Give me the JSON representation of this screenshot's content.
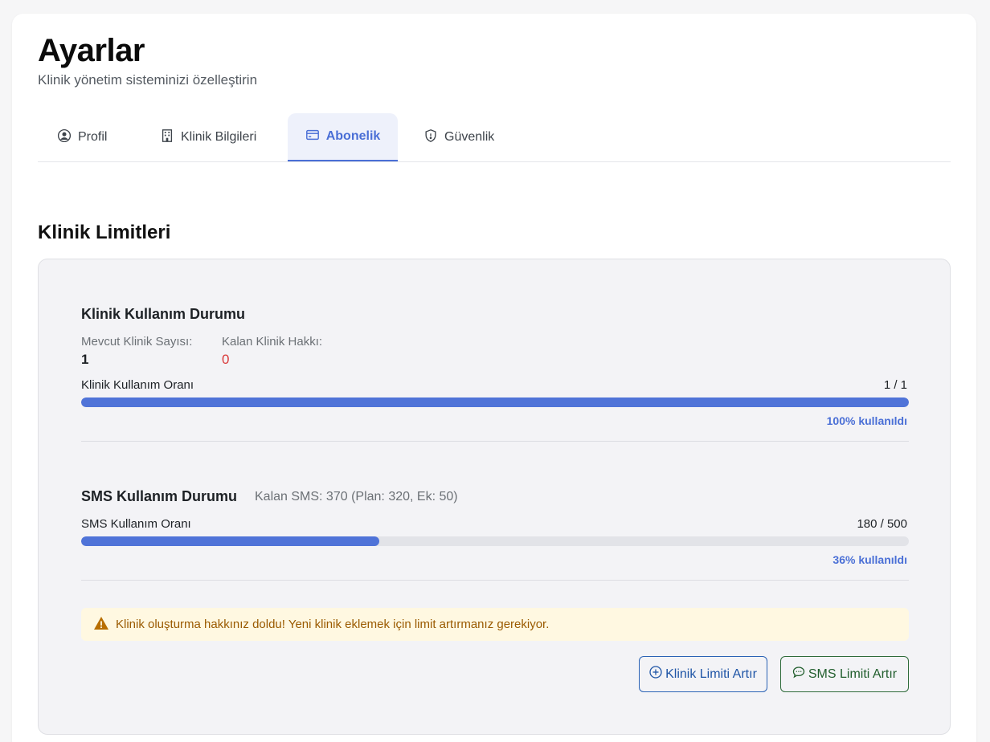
{
  "header": {
    "title": "Ayarlar",
    "subtitle": "Klinik yönetim sisteminizi özelleştirin"
  },
  "tabs": [
    {
      "label": "Profil",
      "icon": "user-circle-icon",
      "active": false
    },
    {
      "label": "Klinik Bilgileri",
      "icon": "building-icon",
      "active": false
    },
    {
      "label": "Abonelik",
      "icon": "credit-card-icon",
      "active": true
    },
    {
      "label": "Güvenlik",
      "icon": "shield-icon",
      "active": false
    }
  ],
  "section": {
    "title": "Klinik Limitleri"
  },
  "clinic_usage": {
    "title": "Klinik Kullanım Durumu",
    "current_label": "Mevcut Klinik Sayısı:",
    "current_value": "1",
    "remaining_label": "Kalan Klinik Hakkı:",
    "remaining_value": "0",
    "rate_label": "Klinik Kullanım Oranı",
    "rate_value": "1 / 1",
    "progress_percent": 100,
    "percent_text": "100% kullanıldı"
  },
  "sms_usage": {
    "title": "SMS Kullanım Durumu",
    "remaining_text": "Kalan SMS: 370 (Plan: 320, Ek: 50)",
    "rate_label": "SMS Kullanım Oranı",
    "rate_value": "180 / 500",
    "progress_percent": 36,
    "percent_text": "36% kullanıldı"
  },
  "alert": {
    "icon": "warning-icon",
    "text": "Klinik oluşturma hakkınız doldu! Yeni klinik eklemek için limit artırmanız gerekiyor."
  },
  "actions": {
    "clinic_limit_label": "Klinik Limiti Artır",
    "sms_limit_label": "SMS Limiti Artır"
  },
  "colors": {
    "accent": "#4a6fd6",
    "progress_fill": "#4f73d8",
    "danger": "#d93a3a",
    "warning_bg": "#fff8e1",
    "warning_text": "#9a5a00",
    "blue_button": "#1f55a6",
    "green_button": "#215e2d"
  }
}
